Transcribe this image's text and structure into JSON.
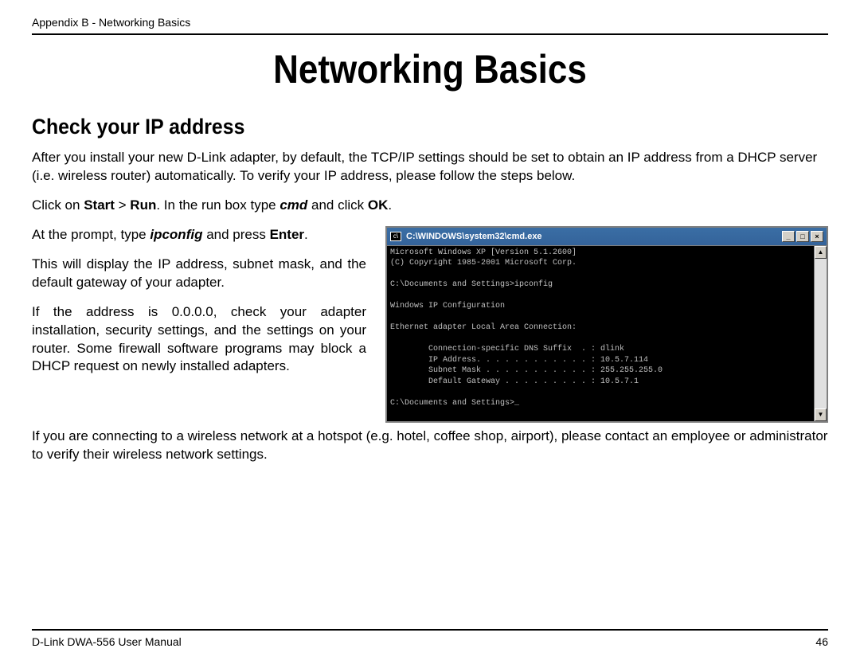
{
  "header": {
    "breadcrumb": "Appendix B - Networking Basics"
  },
  "title": "Networking Basics",
  "subtitle": "Check your IP address",
  "intro": "After you install your new D-Link adapter, by default, the TCP/IP settings should be set to obtain an IP address from a DHCP server (i.e. wireless router) automatically. To verify your IP address, please follow the steps below.",
  "step1": {
    "pre": "Click on ",
    "b1": "Start",
    "gt": " > ",
    "b2": "Run",
    "mid": ". In the run box type ",
    "cmd": "cmd",
    "post": " and click ",
    "b3": "OK",
    "end": "."
  },
  "step2": {
    "pre": "At the prompt, type ",
    "cmd": "ipconfig",
    "mid": " and press ",
    "b1": "Enter",
    "end": "."
  },
  "para3": "This will display the IP address, subnet mask, and the default gateway of your adapter.",
  "para4": "If the address is 0.0.0.0, check your adapter installation, security settings, and the settings on your router. Some firewall software programs may block a DHCP request on newly installed adapters.",
  "para5": "If you are connecting to a wireless network at a hotspot (e.g. hotel, coffee shop, airport), please contact an employee or administrator to verify their wireless network settings.",
  "cmd_window": {
    "title": "C:\\WINDOWS\\system32\\cmd.exe",
    "content": "Microsoft Windows XP [Version 5.1.2600]\n(C) Copyright 1985-2001 Microsoft Corp.\n\nC:\\Documents and Settings>ipconfig\n\nWindows IP Configuration\n\nEthernet adapter Local Area Connection:\n\n        Connection-specific DNS Suffix  . : dlink\n        IP Address. . . . . . . . . . . . : 10.5.7.114\n        Subnet Mask . . . . . . . . . . . : 255.255.255.0\n        Default Gateway . . . . . . . . . : 10.5.7.1\n\nC:\\Documents and Settings>_"
  },
  "footer": {
    "manual": "D-Link DWA-556 User Manual",
    "page": "46"
  }
}
